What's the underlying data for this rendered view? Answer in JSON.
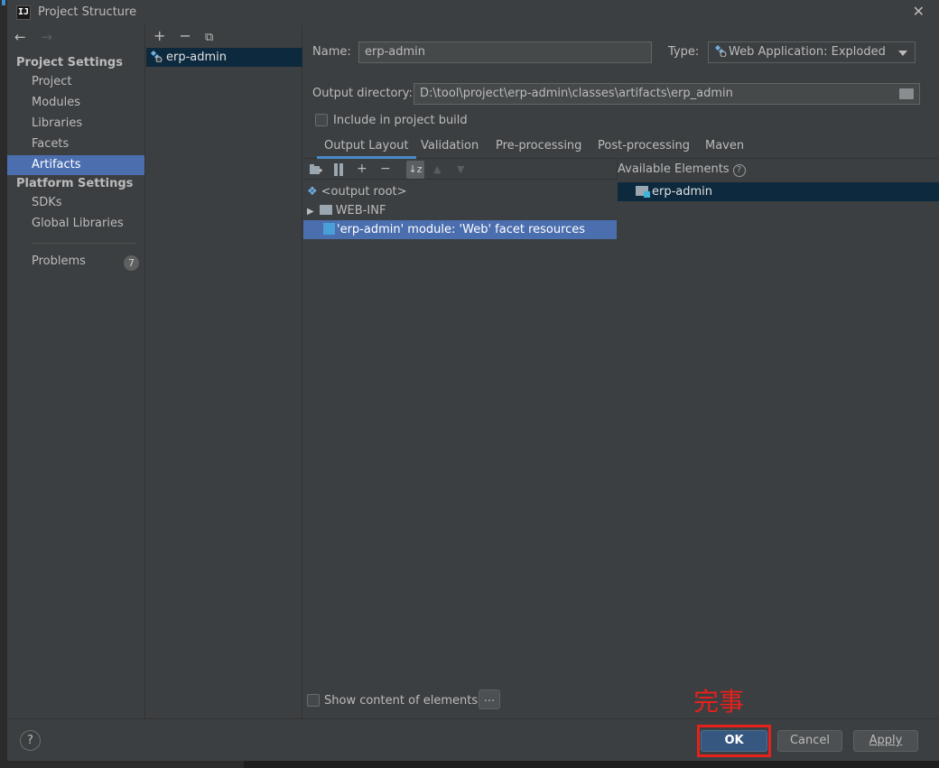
{
  "window": {
    "title": "Project Structure",
    "close_glyph": "✕"
  },
  "nav": {
    "back": "←",
    "forward": "→",
    "project_settings_header": "Project Settings",
    "project_items": [
      "Project",
      "Modules",
      "Libraries",
      "Facets",
      "Artifacts"
    ],
    "platform_settings_header": "Platform Settings",
    "platform_items": [
      "SDKs",
      "Global Libraries"
    ],
    "problems_label": "Problems",
    "problems_count": "7",
    "selected": "Artifacts"
  },
  "artifacts_list": {
    "add": "+",
    "remove": "−",
    "copy": "⧉",
    "items": [
      "erp-admin"
    ]
  },
  "main": {
    "name_label": "Name:",
    "name_value": "erp-admin",
    "type_label": "Type:",
    "type_value": "Web Application: Exploded",
    "output_dir_label": "Output directory:",
    "output_dir_value": "D:\\tool\\project\\erp-admin\\classes\\artifacts\\erp_admin",
    "include_in_build_label": "Include in project build",
    "include_in_build_checked": false,
    "tabs": [
      "Output Layout",
      "Validation",
      "Pre-processing",
      "Post-processing",
      "Maven"
    ],
    "active_tab": "Output Layout",
    "layout_tree": [
      {
        "label": "<output root>",
        "icon": "diamond-icon"
      },
      {
        "label": "WEB-INF",
        "icon": "folder-icon"
      },
      {
        "label": "'erp-admin' module: 'Web' facet resources",
        "icon": "web-resource-icon"
      }
    ],
    "available_elements_label": "Available Elements",
    "available_elements": [
      "erp-admin"
    ],
    "show_content_label": "Show content of elements",
    "ellipsis_button": "..."
  },
  "footer": {
    "help": "?",
    "ok": "OK",
    "cancel": "Cancel",
    "apply": "Apply"
  },
  "annotation": {
    "text": "完事",
    "color": "#e6211b"
  },
  "colors": {
    "selection": "#4b6eaf",
    "background": "#3c3f41",
    "ok_button": "#365880"
  }
}
